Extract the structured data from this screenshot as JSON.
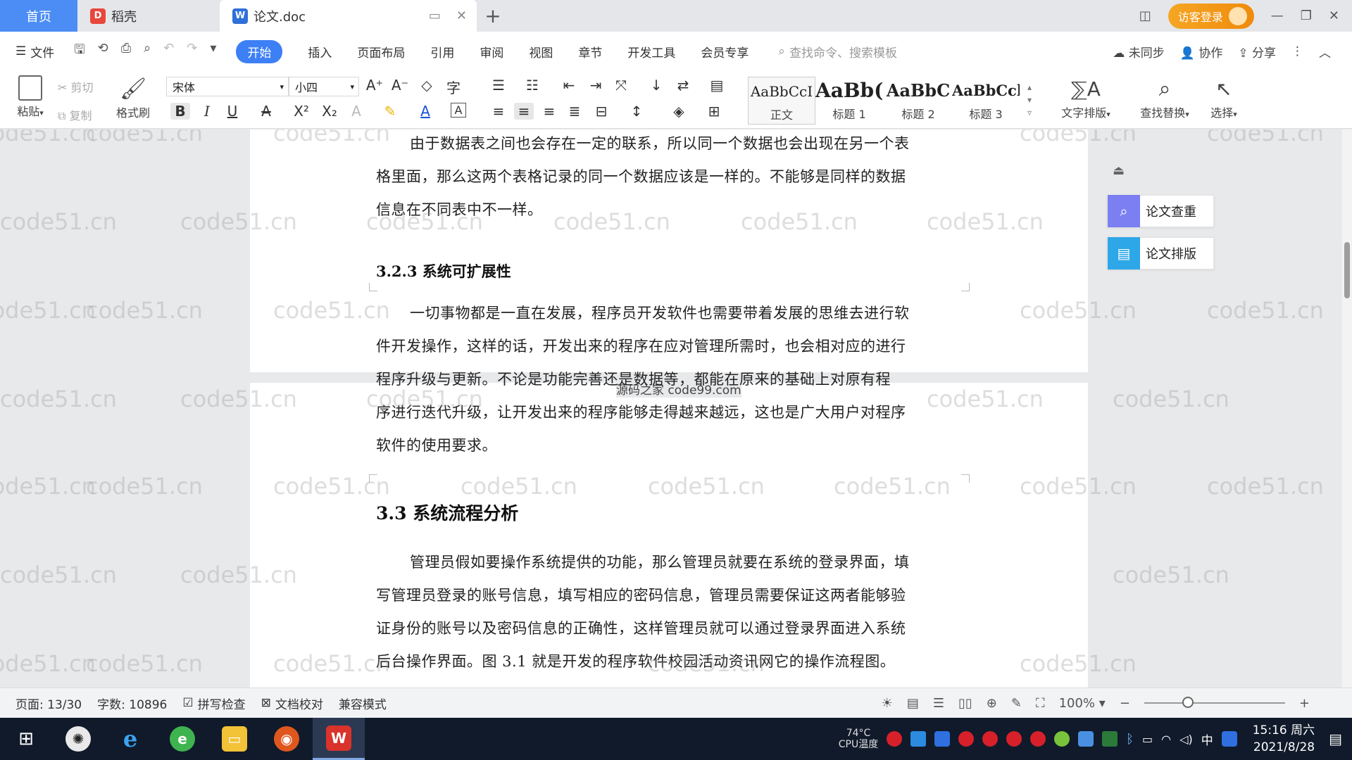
{
  "tabs": {
    "home": "首页",
    "daoke": "稻壳",
    "doc": "论文.doc",
    "login": "访客登录"
  },
  "menu": {
    "file": "文件",
    "items": [
      "开始",
      "插入",
      "页面布局",
      "引用",
      "审阅",
      "视图",
      "章节",
      "开发工具",
      "会员专享"
    ],
    "search_placeholder": "查找命令、搜索模板",
    "sync": "未同步",
    "collab": "协作",
    "share": "分享"
  },
  "ribbon": {
    "paste": "粘贴",
    "cut": "剪切",
    "copy": "复制",
    "format_painter": "格式刷",
    "font_name": "宋体",
    "font_size": "小四",
    "styles": [
      {
        "preview": "AaBbCcI",
        "label": "正文"
      },
      {
        "preview": "AaBb(",
        "label": "标题 1"
      },
      {
        "preview": "AaBbC",
        "label": "标题 2"
      },
      {
        "preview": "AaBbCcl",
        "label": "标题 3"
      }
    ],
    "text_layout": "文字排版",
    "find_replace": "查找替换",
    "select": "选择"
  },
  "document": {
    "para1_l1": "由于数据表之间也会存在一定的联系，所以同一个数据也会出现在另一个表",
    "para1_l2": "格里面，那么这两个表格记录的同一个数据应该是一样的。不能够是同样的数据",
    "para1_l3": "信息在不同表中不一样。",
    "heading_323": "3.2.3 系统可扩展性",
    "para2_l1": "一切事物都是一直在发展，程序员开发软件也需要带着发展的思维去进行软",
    "para2_l2": "件开发操作，这样的话，开发出来的程序在应对管理所需时，也会相对应的进行",
    "para2_l3": "程序升级与更新。不论是功能完善还是数据等，都能在原来的基础上对原有程",
    "para2_l4": "序进行迭代升级，让开发出来的程序能够走得越来越远，这也是广大用户对程序",
    "para2_l5": "软件的使用要求。",
    "page_break_label": "源码之家 code99.com",
    "heading_33": "3.3 系统流程分析",
    "para3_l1": "管理员假如要操作系统提供的功能，那么管理员就要在系统的登录界面，填",
    "para3_l2": "写管理员登录的账号信息，填写相应的密码信息，管理员需要保证这两者能够验",
    "para3_l3": "证身份的账号以及密码信息的正确性，这样管理员就可以通过登录界面进入系统",
    "para3_l4": "后台操作界面。图 3.1 就是开发的程序软件校园活动资讯网它的操作流程图。",
    "watermark": "code51.cn"
  },
  "side_panel": {
    "check": "论文查重",
    "format": "论文排版"
  },
  "status": {
    "page": "页面: 13/30",
    "words": "字数: 10896",
    "spell": "拼写检查",
    "proof": "文档校对",
    "compat": "兼容模式",
    "zoom": "100%",
    "zoom_value": 100
  },
  "taskbar": {
    "cpu_temp": "74°C",
    "cpu_label": "CPU温度",
    "ime": "中",
    "time": "15:16 周六",
    "date": "2021/8/28"
  },
  "colors": {
    "accent": "#3d7ff5",
    "home_tab": "#4c8df5",
    "login": "#f5a623",
    "taskbar": "#101a2a"
  }
}
